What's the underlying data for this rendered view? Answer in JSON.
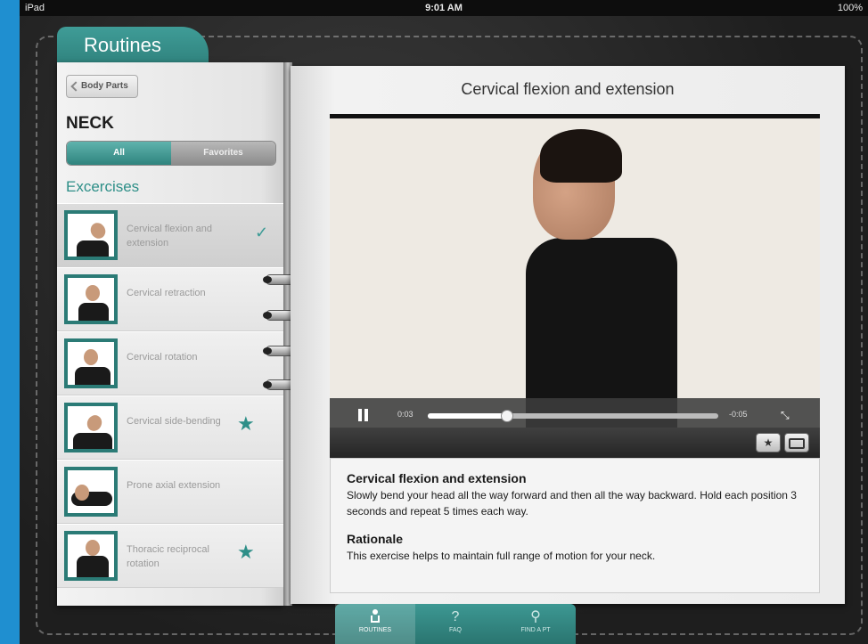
{
  "status_bar": {
    "device": "iPad",
    "time": "9:01 AM",
    "battery": "100%"
  },
  "app": {
    "tab_title": "Routines",
    "back_button": "Body Parts",
    "section_title": "NECK",
    "segments": {
      "all": "All",
      "favorites": "Favorites"
    },
    "list_heading": "Excercises",
    "exercises": [
      {
        "label": "Cervical flexion and extension",
        "selected": true,
        "checked": true,
        "favorite": false
      },
      {
        "label": "Cervical retraction",
        "selected": false,
        "checked": false,
        "favorite": false
      },
      {
        "label": "Cervical rotation",
        "selected": false,
        "checked": false,
        "favorite": false
      },
      {
        "label": "Cervical side-bending",
        "selected": false,
        "checked": false,
        "favorite": true
      },
      {
        "label": "Prone axial extension",
        "selected": false,
        "checked": false,
        "favorite": false
      },
      {
        "label": "Thoracic reciprocal rotation",
        "selected": false,
        "checked": false,
        "favorite": true
      }
    ],
    "check_glyph": "✓",
    "star_glyph": "★"
  },
  "detail": {
    "title": "Cervical flexion and extension",
    "video": {
      "elapsed": "0:03",
      "remaining": "-0:05",
      "progress": 0.27,
      "fav_glyph": "★"
    },
    "description_heading": "Cervical flexion and extension",
    "description_text": "Slowly bend your head all the way forward and then all the way backward. Hold each position 3 seconds and repeat 5 times each way.",
    "rationale_heading": "Rationale",
    "rationale_text": "This exercise helps to maintain full range of motion for your neck."
  },
  "tabbar": {
    "routines": "ROUTINES",
    "faq": "FAQ",
    "find": "FIND A PT",
    "faq_glyph": "?",
    "find_glyph": "⚲"
  },
  "colors": {
    "accent": "#2e8f88",
    "background": "#1f8fd0"
  }
}
